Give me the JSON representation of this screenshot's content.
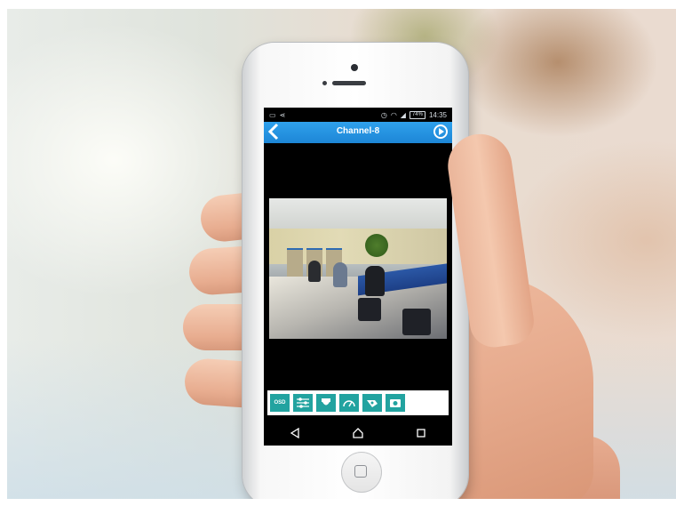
{
  "status_bar": {
    "time": "14:35",
    "battery": "74%"
  },
  "header": {
    "title": "Channel-8"
  },
  "toolbar": {
    "osd_label": "OSD",
    "buttons": [
      "osd-icon",
      "sliders-icon",
      "ptz-camera-icon",
      "speedometer-icon",
      "snapshot-icon",
      "camera-icon"
    ]
  },
  "android_nav": {
    "buttons": [
      "back-triangle-icon",
      "home-icon",
      "recent-apps-icon"
    ]
  },
  "colors": {
    "title_bar": "#1d86d6",
    "toolbar_button": "#22a3a0",
    "screen_background": "#000000"
  }
}
